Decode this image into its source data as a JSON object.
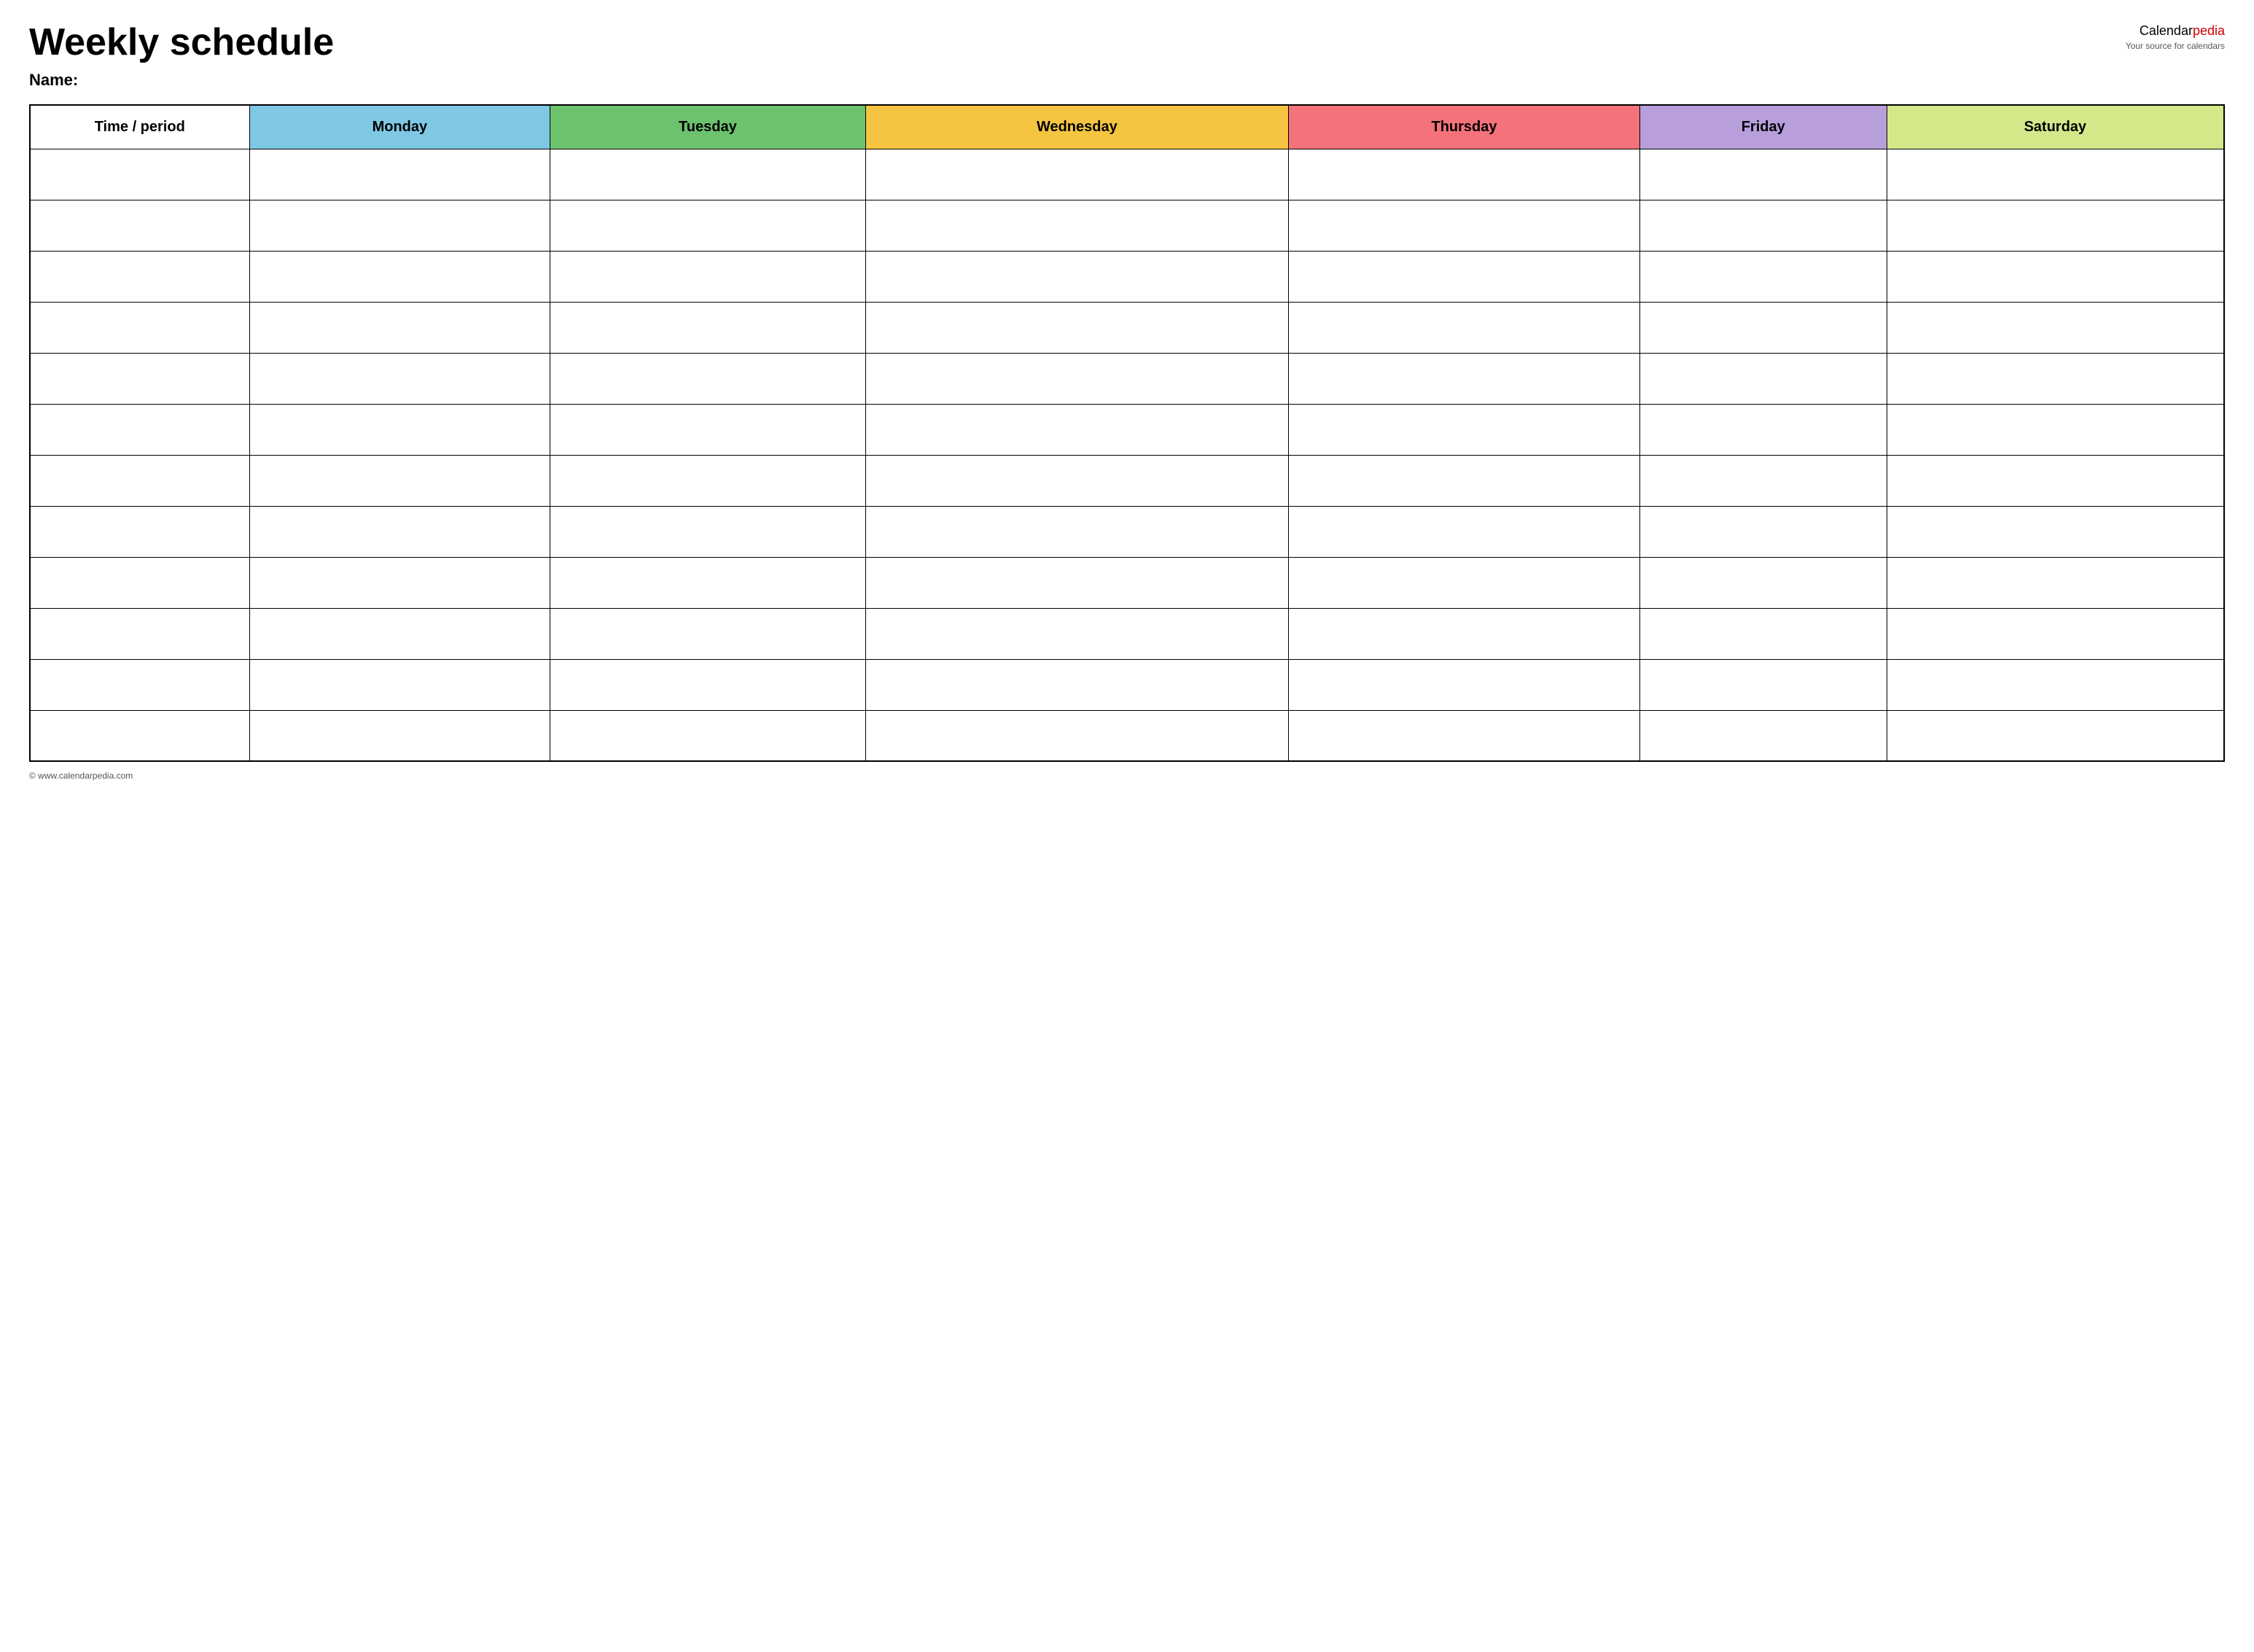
{
  "header": {
    "title": "Weekly schedule",
    "logo_main": "Calendar",
    "logo_highlight": "pedia",
    "logo_subtitle": "Your source for calendars",
    "name_label": "Name:"
  },
  "columns": [
    {
      "key": "time",
      "label": "Time / period",
      "class": "col-time"
    },
    {
      "key": "monday",
      "label": "Monday",
      "class": "col-monday"
    },
    {
      "key": "tuesday",
      "label": "Tuesday",
      "class": "col-tuesday"
    },
    {
      "key": "wednesday",
      "label": "Wednesday",
      "class": "col-wednesday"
    },
    {
      "key": "thursday",
      "label": "Thursday",
      "class": "col-thursday"
    },
    {
      "key": "friday",
      "label": "Friday",
      "class": "col-friday"
    },
    {
      "key": "saturday",
      "label": "Saturday",
      "class": "col-saturday"
    }
  ],
  "rows": 12,
  "footer": {
    "url": "© www.calendarpedia.com"
  }
}
